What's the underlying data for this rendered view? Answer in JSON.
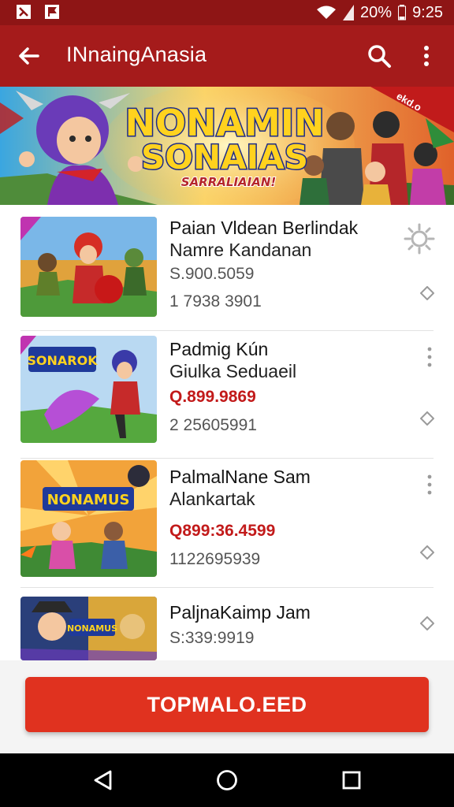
{
  "status_bar": {
    "battery": "20%",
    "time": "9:25"
  },
  "app_bar": {
    "title": "INnaingAnasia"
  },
  "banner": {
    "headline_line1": "NONAMIN",
    "headline_line2": "SONAIAS",
    "tagline": "SARRALIAIAN!",
    "ribbon_text": "ekd.o"
  },
  "items": [
    {
      "line1": "Paian Vldean Berlindak",
      "line2": "Namre Kandanan",
      "line3": "S.900.5059",
      "line4": "1 7938 3901",
      "price_red": false,
      "badge": "",
      "side_icon": "gear-icon"
    },
    {
      "line1": "Padmig Kún",
      "line2": "Giulka Seduaeil",
      "line3": "Q.899.9869",
      "line4": "2 25605991",
      "price_red": true,
      "badge": "SONAROK",
      "side_icon": "more-vert-icon"
    },
    {
      "line1": "PalmalNane Sam",
      "line2": "Alankartak",
      "line3": "Q899:36.4599",
      "line4": "1122695939",
      "price_red": true,
      "badge": "NONAMUS",
      "side_icon": "more-vert-icon"
    },
    {
      "line1": "PaljnaKaimp Jam",
      "line2": "",
      "line3": "S:339:9919",
      "line4": "",
      "price_red": false,
      "badge": "NONAMUS",
      "side_icon": ""
    }
  ],
  "cta": {
    "label": "TOPMALO.EED"
  },
  "colors": {
    "status_bar": "#8e1515",
    "app_bar": "#a51b1b",
    "cta": "#e0321f",
    "price_red": "#c21a1a"
  }
}
